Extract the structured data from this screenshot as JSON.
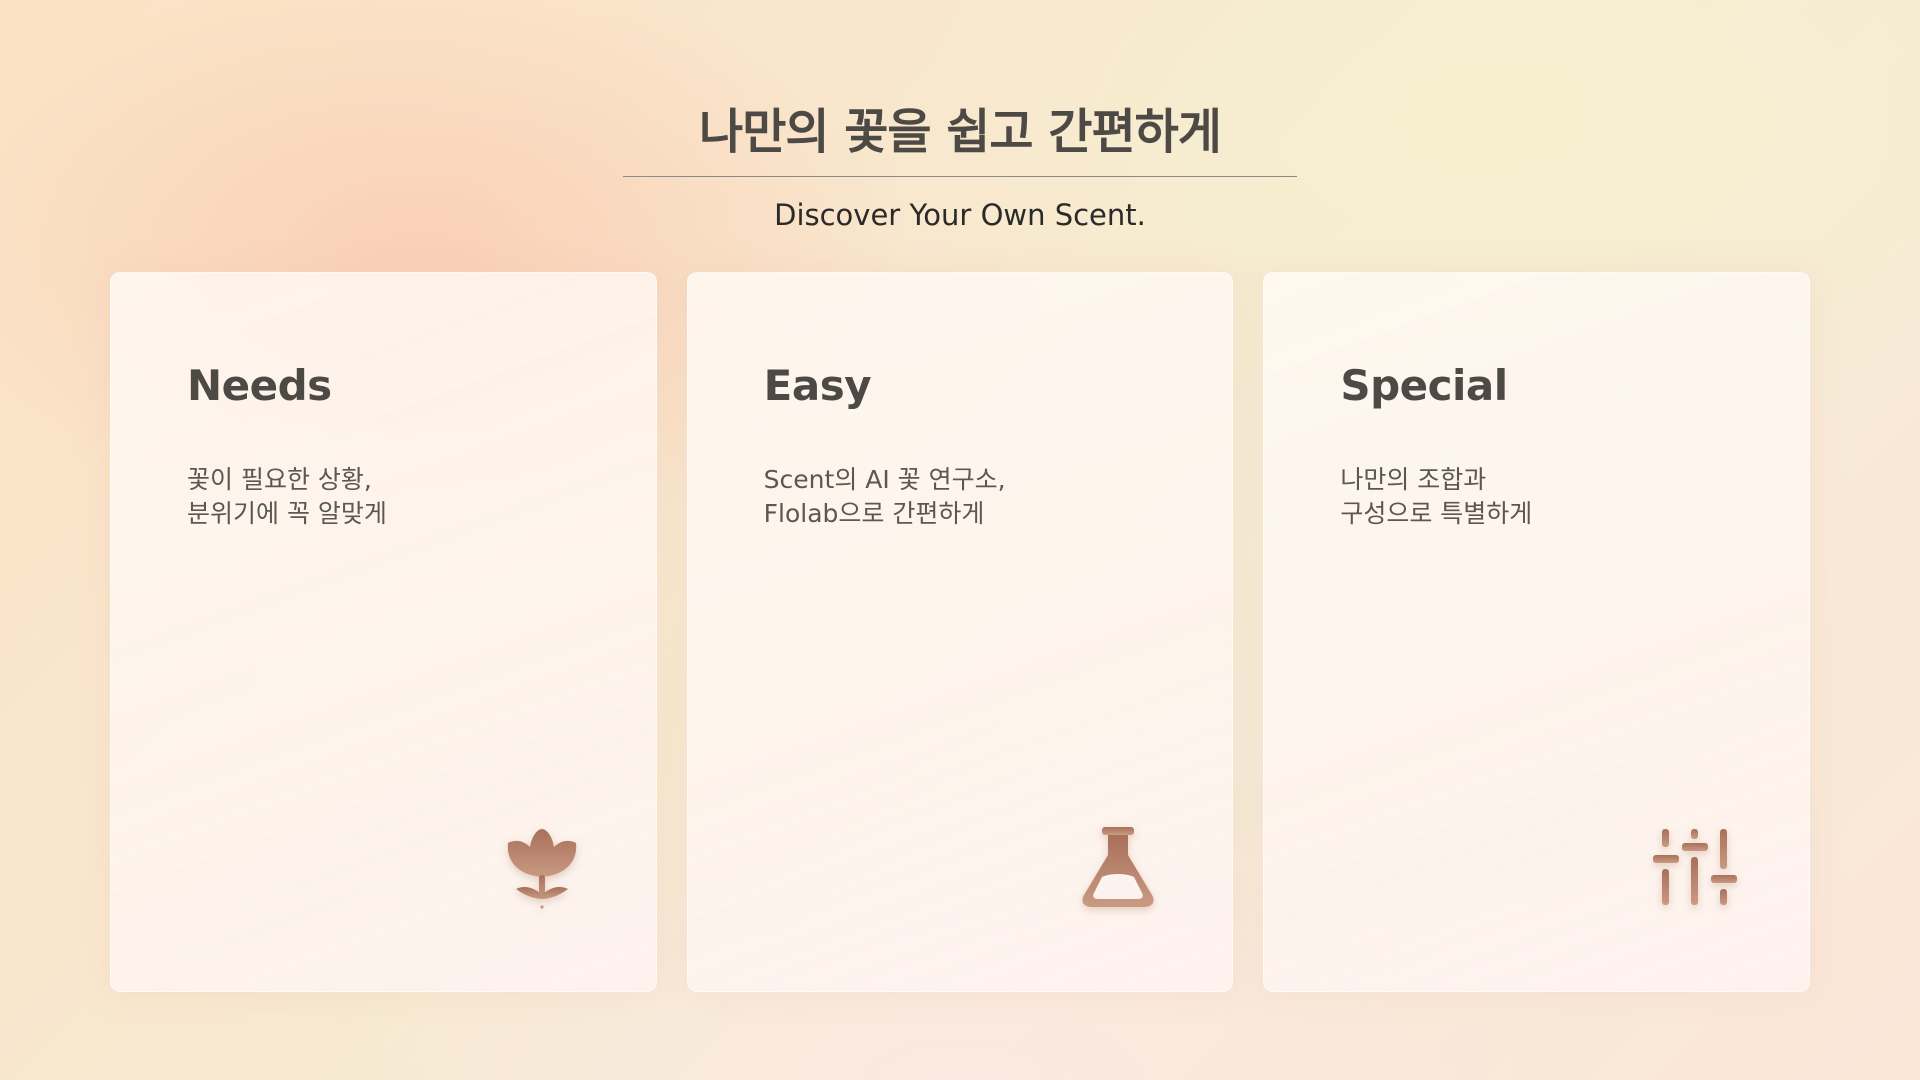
{
  "header": {
    "title": "나만의 꽃을 쉽고 간편하게",
    "subtitle": "Discover Your Own Scent."
  },
  "colors": {
    "text_dark": "#4d4a46",
    "icon_brown": "#b07860"
  },
  "cards": [
    {
      "title": "Needs",
      "desc_line1": "꽃이 필요한 상황,",
      "desc_line2": "분위기에 꼭 알맞게",
      "icon": "flower-icon"
    },
    {
      "title": "Easy",
      "desc_line1": "Scent의 AI 꽃 연구소,",
      "desc_line2": "Flolab으로 간편하게",
      "icon": "flask-icon"
    },
    {
      "title": "Special",
      "desc_line1": "나만의 조합과",
      "desc_line2": "구성으로 특별하게",
      "icon": "sliders-icon"
    }
  ]
}
